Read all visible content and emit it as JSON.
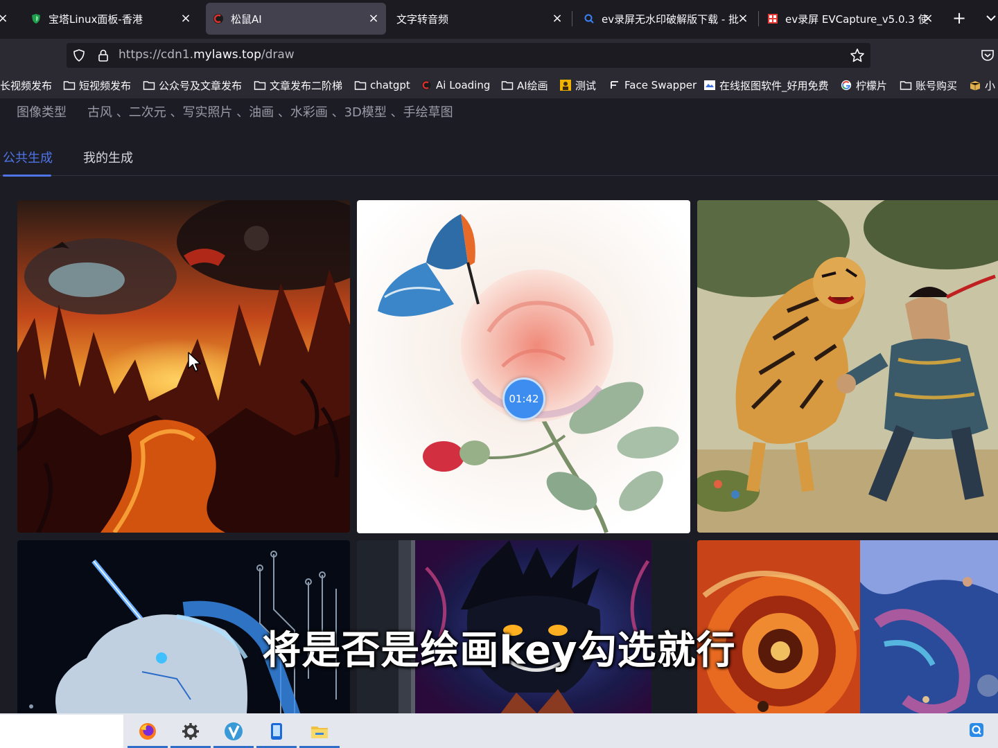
{
  "browser": {
    "tabs": [
      {
        "title": "宝塔Linux面板-香港",
        "active": false,
        "favicon": "shield-green-icon"
      },
      {
        "title": "松鼠AI",
        "active": true,
        "favicon": "squirrel-ai-icon"
      },
      {
        "title": "文字转音频",
        "active": false,
        "favicon": "none"
      },
      {
        "title": "ev录屏无水印破解版下载 - 批",
        "active": false,
        "favicon": "search-icon"
      },
      {
        "title": "ev录屏 EVCapture_v5.0.3 使",
        "active": false,
        "favicon": "red-site-icon"
      }
    ],
    "new_tab_label": "+",
    "close_glyph": "×",
    "url": {
      "prefix": "https://cdn1.",
      "host": "mylaws.top",
      "path": "/draw"
    },
    "bookmarks": [
      {
        "label": "长视频发布",
        "icon": "none"
      },
      {
        "label": "短视频发布",
        "icon": "folder-icon"
      },
      {
        "label": "公众号及文章发布",
        "icon": "folder-icon"
      },
      {
        "label": "文章发布二阶梯",
        "icon": "folder-icon"
      },
      {
        "label": "chatgpt",
        "icon": "folder-icon"
      },
      {
        "label": "Ai Loading",
        "icon": "ai-loading-icon"
      },
      {
        "label": "AI绘画",
        "icon": "folder-icon"
      },
      {
        "label": "测试",
        "icon": "test-site-icon"
      },
      {
        "label": "Face Swapper",
        "icon": "face-swapper-icon"
      },
      {
        "label": "在线抠图软件_好用免费",
        "icon": "cutout-site-icon"
      },
      {
        "label": "柠檬片",
        "icon": "google-icon"
      },
      {
        "label": "账号购买",
        "icon": "folder-icon"
      },
      {
        "label": "小",
        "icon": "package-icon"
      }
    ]
  },
  "page": {
    "image_type_label": "图像类型",
    "image_types": "古风 、二次元 、写实照片 、油画 、水彩画 、3D模型 、手绘草图",
    "tabs": [
      {
        "label": "公共生成",
        "active": true
      },
      {
        "label": "我的生成",
        "active": false
      }
    ],
    "gallery": [
      {
        "name": "hellscape-lava-image"
      },
      {
        "name": "butterfly-rose-image"
      },
      {
        "name": "tiger-warrior-image"
      },
      {
        "name": "cyber-unicorn-image"
      },
      {
        "name": "demon-face-image"
      },
      {
        "name": "cosmic-swirl-image"
      }
    ],
    "timer": "01:42",
    "video_subtitle": "将是否是绘画key勾选就行"
  },
  "taskbar": {
    "apps": [
      "firefox-icon",
      "settings-gear-icon",
      "v-app-icon",
      "phone-app-icon",
      "file-explorer-icon"
    ],
    "tray_icon": "q-tray-icon"
  },
  "colors": {
    "accent": "#4f74e8",
    "tab_active": "#42414d",
    "toolbar": "#2b2a33",
    "page_bg": "#1c1c24"
  }
}
